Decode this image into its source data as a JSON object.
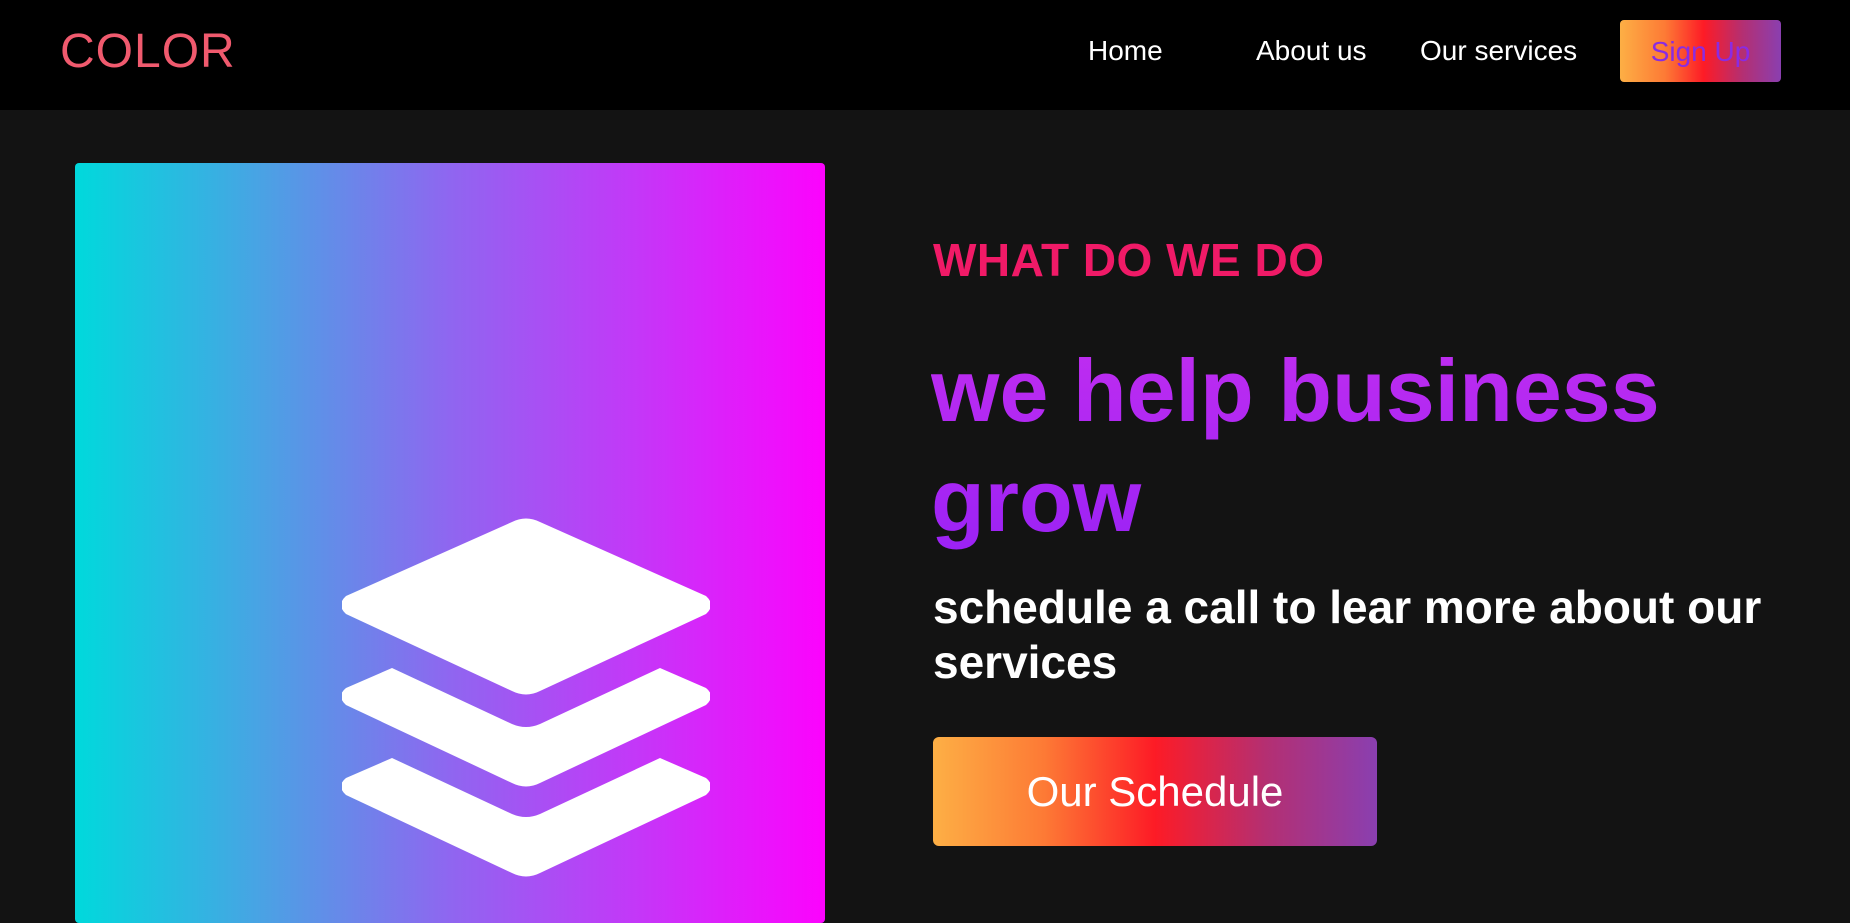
{
  "navbar": {
    "logo": "COLOR",
    "links": [
      {
        "label": "Home"
      },
      {
        "label": "About us"
      },
      {
        "label": "Our services"
      }
    ],
    "signup_label": "Sign Up"
  },
  "hero": {
    "image_icon": "layers-icon",
    "eyebrow": "WHAT DO WE DO",
    "headline": "we help business grow",
    "subheading": "schedule a call to lear more about our services",
    "cta_label": "Our Schedule"
  },
  "colors": {
    "page_background": "#131313",
    "navbar_background": "#000000",
    "logo": "#f05a6e",
    "eyebrow": "#f01a67",
    "headline": "#b62af2",
    "signup_text": "#8a2be2",
    "gradient_image": [
      "#00d9dc",
      "#fc03fd"
    ],
    "gradient_button": [
      "#fdaf45",
      "#fd1b26",
      "#8a3fb0"
    ]
  }
}
